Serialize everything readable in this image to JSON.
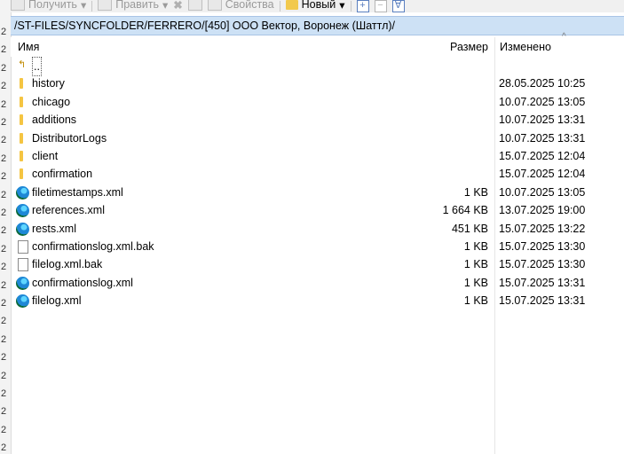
{
  "toolbar": {
    "get_label": "Получить",
    "edit_label": "Править",
    "properties_label": "Свойства",
    "new_label": "Новый"
  },
  "path": "/ST-FILES/SYNCFOLDER/FERRERO/[450] ООО Вектор, Воронеж (Шаттл)/",
  "columns": {
    "name": "Имя",
    "size": "Размер",
    "modified": "Изменено"
  },
  "left_strip_char": "2",
  "files": [
    {
      "name": "..",
      "type": "parent",
      "size": "",
      "modified": ""
    },
    {
      "name": "history",
      "type": "folder",
      "size": "",
      "modified": "28.05.2025 10:25"
    },
    {
      "name": "chicago",
      "type": "folder",
      "size": "",
      "modified": "10.07.2025 13:05"
    },
    {
      "name": "additions",
      "type": "folder",
      "size": "",
      "modified": "10.07.2025 13:31"
    },
    {
      "name": "DistributorLogs",
      "type": "folder",
      "size": "",
      "modified": "10.07.2025 13:31"
    },
    {
      "name": "client",
      "type": "folder",
      "size": "",
      "modified": "15.07.2025 12:04"
    },
    {
      "name": "confirmation",
      "type": "folder",
      "size": "",
      "modified": "15.07.2025 12:04"
    },
    {
      "name": "filetimestamps.xml",
      "type": "xml",
      "size": "1 KB",
      "modified": "10.07.2025 13:05"
    },
    {
      "name": "references.xml",
      "type": "xml",
      "size": "1 664 KB",
      "modified": "13.07.2025 19:00"
    },
    {
      "name": "rests.xml",
      "type": "xml",
      "size": "451 KB",
      "modified": "15.07.2025 13:22"
    },
    {
      "name": "confirmationslog.xml.bak",
      "type": "file",
      "size": "1 KB",
      "modified": "15.07.2025 13:30"
    },
    {
      "name": "filelog.xml.bak",
      "type": "file",
      "size": "1 KB",
      "modified": "15.07.2025 13:30"
    },
    {
      "name": "confirmationslog.xml",
      "type": "xml",
      "size": "1 KB",
      "modified": "15.07.2025 13:31"
    },
    {
      "name": "filelog.xml",
      "type": "xml",
      "size": "1 KB",
      "modified": "15.07.2025 13:31"
    }
  ]
}
